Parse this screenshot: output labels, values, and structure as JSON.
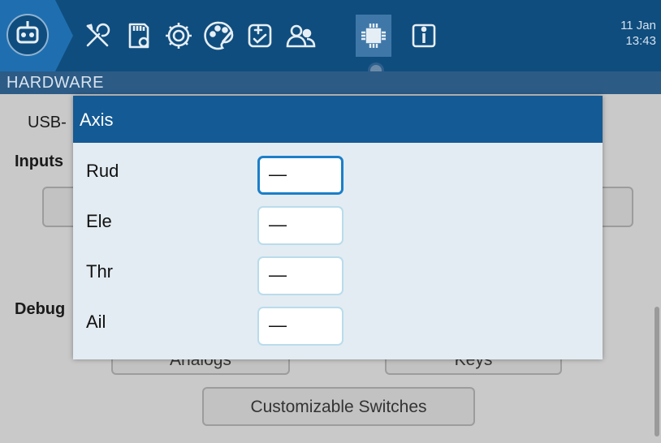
{
  "topbar": {
    "icons": [
      "radio-model-icon",
      "wrench-screwdriver-icon",
      "sd-card-icon",
      "gear-icon",
      "palette-icon",
      "checklist-icon",
      "users-icon",
      "chip-icon",
      "info-icon"
    ],
    "date": "11 Jan",
    "time": "13:43",
    "colors": {
      "bar": "#0f4d7e",
      "active_tab": "#3f78a8"
    }
  },
  "page": {
    "section_title": "HARDWARE",
    "usb_label": "USB-",
    "inputs_label": "Inputs",
    "debug_label": "Debug",
    "buttons": {
      "analogs": "Analogs",
      "keys": "Keys",
      "customizable_switches": "Customizable Switches"
    }
  },
  "dialog": {
    "title": "Axis",
    "rows": [
      {
        "label": "Rud",
        "value": "—"
      },
      {
        "label": "Ele",
        "value": "—"
      },
      {
        "label": "Thr",
        "value": "—"
      },
      {
        "label": "Ail",
        "value": "—"
      }
    ],
    "colors": {
      "header": "#145a94",
      "focus_border": "#1b7fc9"
    }
  }
}
